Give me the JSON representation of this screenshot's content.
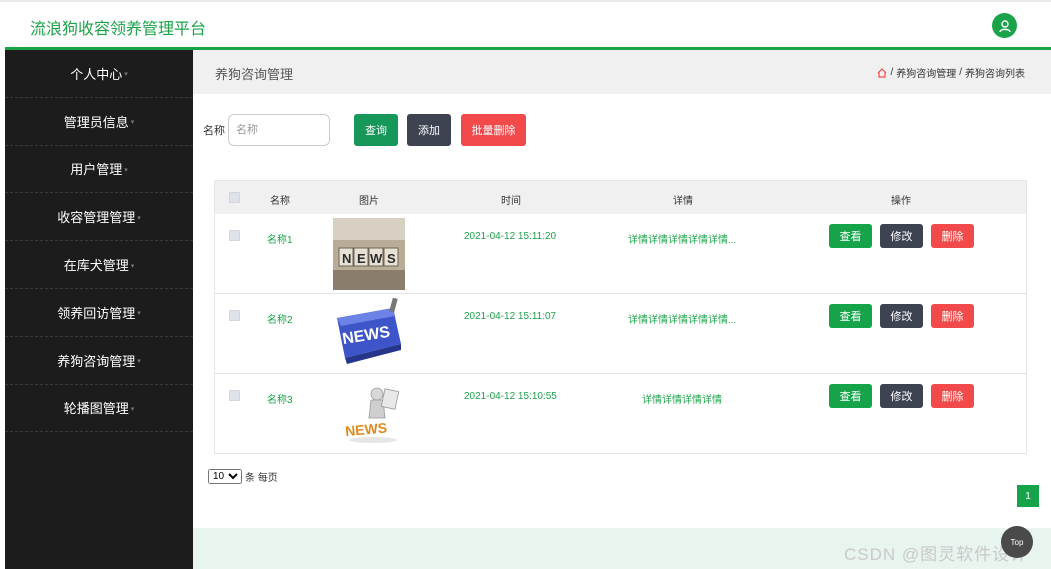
{
  "app": {
    "title": "流浪狗收容领养管理平台"
  },
  "sidebar": {
    "items": [
      {
        "label": "个人中心"
      },
      {
        "label": "管理员信息"
      },
      {
        "label": "用户管理"
      },
      {
        "label": "收容管理管理"
      },
      {
        "label": "在库犬管理"
      },
      {
        "label": "领养回访管理"
      },
      {
        "label": "养狗咨询管理"
      },
      {
        "label": "轮播图管理"
      }
    ]
  },
  "page": {
    "title": "养狗咨询管理"
  },
  "breadcrumb": {
    "sep": "/",
    "items": [
      "养狗咨询管理",
      "养狗咨询列表"
    ]
  },
  "search": {
    "label": "名称",
    "placeholder": "名称",
    "value": ""
  },
  "toolbar": {
    "query_label": "查询",
    "add_label": "添加",
    "batch_delete_label": "批量删除"
  },
  "table": {
    "headers": [
      "名称",
      "图片",
      "时间",
      "详情",
      "操作"
    ],
    "rows": [
      {
        "name": "名称1",
        "time": "2021-04-12 15:11:20",
        "detail": "详情详情详情详情详情...",
        "image": "news-blocks"
      },
      {
        "name": "名称2",
        "time": "2021-04-12 15:11:07",
        "detail": "详情详情详情详情详情...",
        "image": "news-key"
      },
      {
        "name": "名称3",
        "time": "2021-04-12 15:10:55",
        "detail": "详情详情详情详情",
        "image": "news-figure"
      }
    ],
    "actions": {
      "view": "查看",
      "edit": "修改",
      "delete": "删除"
    }
  },
  "pagination": {
    "page_size": "10",
    "page_size_options": [
      "10"
    ],
    "per_page_label": "条 每页",
    "current_page": "1"
  },
  "to_top": {
    "label": "Top"
  },
  "watermark": {
    "text": "CSDN @图灵软件设计"
  },
  "colors": {
    "brand": "#1ba34a",
    "dark": "#1c1c1c",
    "danger": "#f24a4a",
    "secondary": "#3e4352"
  }
}
